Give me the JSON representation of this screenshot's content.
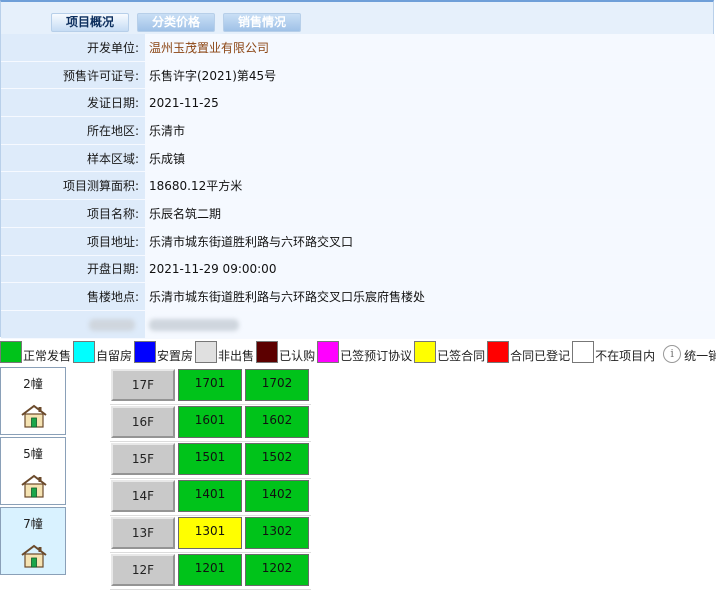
{
  "tabs": [
    "项目概况",
    "分类价格",
    "销售情况"
  ],
  "info": [
    {
      "label": "开发单位:",
      "value": "温州玉茂置业有限公司",
      "link": true
    },
    {
      "label": "预售许可证号:",
      "value": "乐售许字(2021)第45号"
    },
    {
      "label": "发证日期:",
      "value": "2021-11-25"
    },
    {
      "label": "所在地区:",
      "value": "乐清市"
    },
    {
      "label": "样本区域:",
      "value": "乐成镇"
    },
    {
      "label": "项目测算面积:",
      "value": "18680.12平方米"
    },
    {
      "label": "项目名称:",
      "value": "乐辰名筑二期"
    },
    {
      "label": "项目地址:",
      "value": "乐清市城东街道胜利路与六环路交叉口"
    },
    {
      "label": "开盘日期:",
      "value": "2021-11-29 09:00:00"
    },
    {
      "label": "售楼地点:",
      "value": "乐清市城东街道胜利路与六环路交叉口乐宸府售楼处"
    }
  ],
  "legend": [
    {
      "label": "正常发售",
      "color": "#00c31a"
    },
    {
      "label": "自留房",
      "color": "#00ffff"
    },
    {
      "label": "安置房",
      "color": "#0000ff"
    },
    {
      "label": "非出售",
      "color": "#e0e0e0"
    },
    {
      "label": "已认购",
      "color": "#5c0000"
    },
    {
      "label": "已签预订协议",
      "color": "#ff00ff"
    },
    {
      "label": "已签合同",
      "color": "#ffff00"
    },
    {
      "label": "合同已登记",
      "color": "#ff0000"
    },
    {
      "label": "不在项目内",
      "color": "#ffffff"
    }
  ],
  "legend_extra": "统一销",
  "buildings": [
    {
      "name": "2幢",
      "selected": false,
      "icon": "house-icon"
    },
    {
      "name": "5幢",
      "selected": false,
      "icon": "house-icon"
    },
    {
      "name": "7幢",
      "selected": true,
      "icon": "house-icon"
    }
  ],
  "floors": [
    {
      "floor": "17F",
      "units": [
        {
          "no": "1701",
          "status": "正常发售"
        },
        {
          "no": "1702",
          "status": "正常发售"
        }
      ]
    },
    {
      "floor": "16F",
      "units": [
        {
          "no": "1601",
          "status": "正常发售"
        },
        {
          "no": "1602",
          "status": "正常发售"
        }
      ]
    },
    {
      "floor": "15F",
      "units": [
        {
          "no": "1501",
          "status": "正常发售"
        },
        {
          "no": "1502",
          "status": "正常发售"
        }
      ]
    },
    {
      "floor": "14F",
      "units": [
        {
          "no": "1401",
          "status": "正常发售"
        },
        {
          "no": "1402",
          "status": "正常发售"
        }
      ]
    },
    {
      "floor": "13F",
      "units": [
        {
          "no": "1301",
          "status": "已签合同"
        },
        {
          "no": "1302",
          "status": "正常发售"
        }
      ]
    },
    {
      "floor": "12F",
      "units": [
        {
          "no": "1201",
          "status": "正常发售"
        },
        {
          "no": "1202",
          "status": "正常发售"
        }
      ]
    }
  ]
}
